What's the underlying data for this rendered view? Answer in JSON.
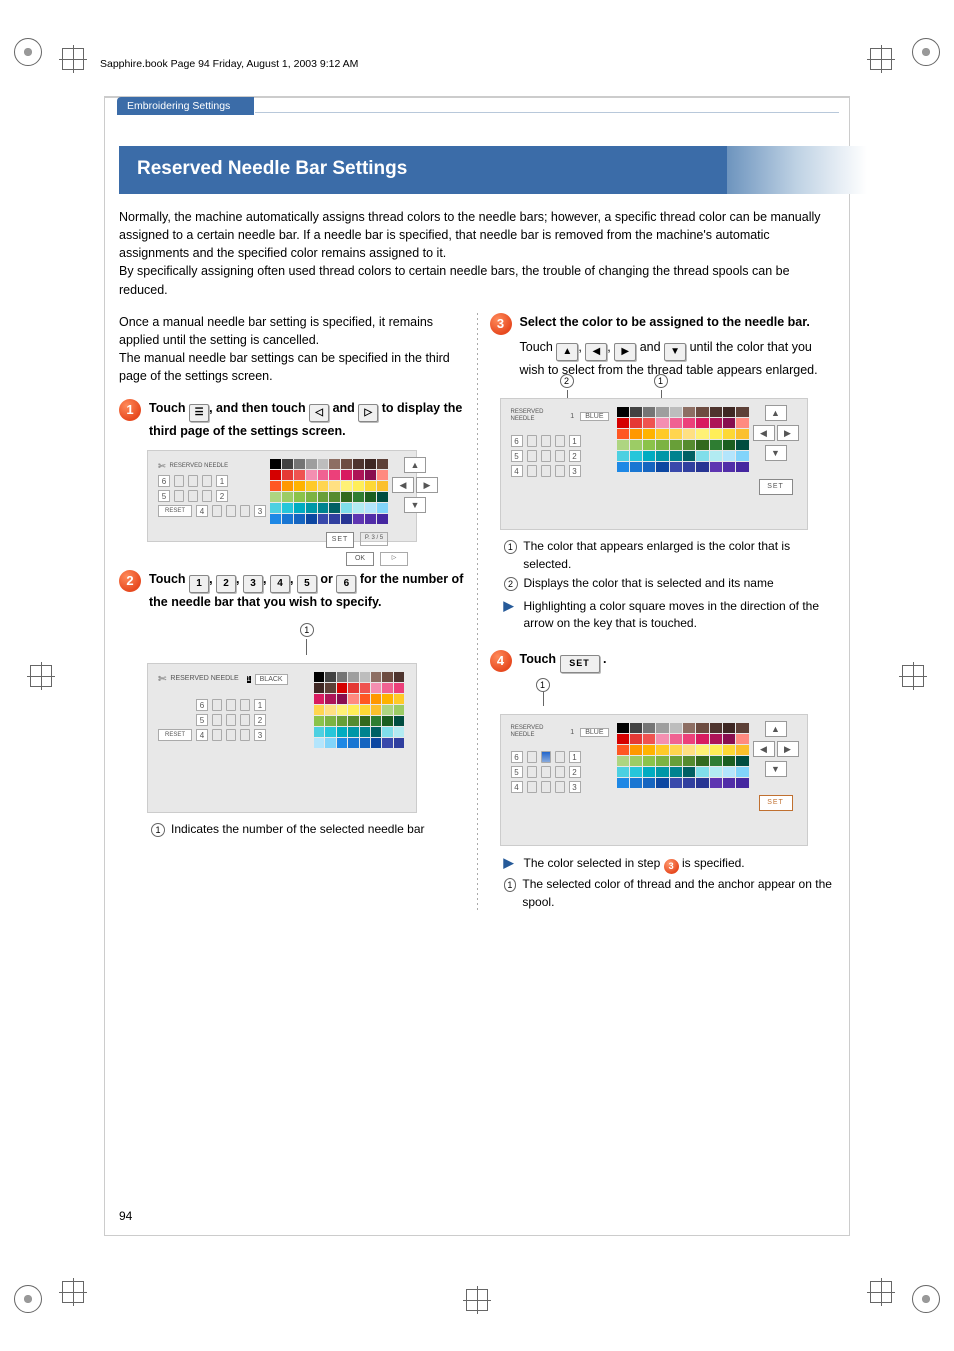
{
  "running_header": "Sapphire.book  Page 94  Friday, August 1, 2003  9:12 AM",
  "section_tab": "Embroidering Settings",
  "title": "Reserved Needle Bar Settings",
  "intro": [
    "Normally, the machine automatically assigns thread colors to the needle bars; however, a specific thread color can be manually assigned to a certain needle bar. If a needle bar is specified, that needle bar is removed from the machine's automatic assignments and the specified color remains assigned to it.",
    "By specifically assigning often used thread colors to certain needle bars, the trouble of changing the thread spools can be reduced."
  ],
  "left_pre": [
    "Once a manual needle bar setting is specified, it remains applied until the setting is cancelled.",
    "The manual needle bar settings can be specified in the third page of the settings screen."
  ],
  "step1": {
    "pre": "Touch",
    "mid": ", and then touch",
    "and_word": "and",
    "post": "to display the third page of the settings screen."
  },
  "step2": {
    "pre": "Touch",
    "btns": [
      "1",
      "2",
      "3",
      "4",
      "5",
      "6"
    ],
    "sep": ",",
    "or_word": "or",
    "post": "for the number of the needle bar that you wish to specify."
  },
  "step2_anno": "Indicates the number of the selected needle bar",
  "step3": {
    "heading": "Select the color to be assigned to the needle bar.",
    "pre": "Touch",
    "mid_sep_word": "and",
    "post": "until the color that you wish to select from the thread table appears enlarged."
  },
  "step3_annos": [
    "The color that appears enlarged is the color that is selected.",
    "Displays the color that is selected and its name"
  ],
  "step3_bullet": "Highlighting a color square moves in the direction of the arrow on the key that is touched.",
  "step4": {
    "pre": "Touch",
    "btn": "SET",
    "post": "."
  },
  "step4_bullet_pre": "The color selected in step",
  "step4_bullet_step": "3",
  "step4_bullet_post": "is specified.",
  "step4_anno": "The selected color of thread and the anchor appear on the spool.",
  "page_number": "94",
  "ss_labels": {
    "reserved_needle": "RESERVED NEEDLE",
    "reset": "RESET",
    "ok": "OK",
    "set": "SET",
    "black": "BLACK",
    "blue": "BLUE",
    "page_ind": "P. 3 / 5"
  },
  "swatch_colors": [
    "#000000",
    "#424242",
    "#757575",
    "#9e9e9e",
    "#bdbdbd",
    "#8d6e63",
    "#6d4c41",
    "#4e342e",
    "#3e2723",
    "#5d4037",
    "#d50000",
    "#e53935",
    "#ef5350",
    "#f48fb1",
    "#f06292",
    "#ec407a",
    "#d81b60",
    "#ad1457",
    "#880e4f",
    "#ff8a80",
    "#ff5722",
    "#ff9800",
    "#ffb300",
    "#ffca28",
    "#ffd54f",
    "#ffe082",
    "#fff176",
    "#ffee58",
    "#fdd835",
    "#fbc02d",
    "#aed581",
    "#9ccc65",
    "#8bc34a",
    "#7cb342",
    "#689f38",
    "#558b2f",
    "#33691e",
    "#2e7d32",
    "#1b5e20",
    "#004d40",
    "#4dd0e1",
    "#26c6da",
    "#00acc1",
    "#0097a7",
    "#00838f",
    "#006064",
    "#80deea",
    "#b2ebf2",
    "#b3e5fc",
    "#81d4fa",
    "#1e88e5",
    "#1976d2",
    "#1565c0",
    "#0d47a1",
    "#3949ab",
    "#303f9f",
    "#283593",
    "#5e35b1",
    "#512da8",
    "#4527a0"
  ]
}
